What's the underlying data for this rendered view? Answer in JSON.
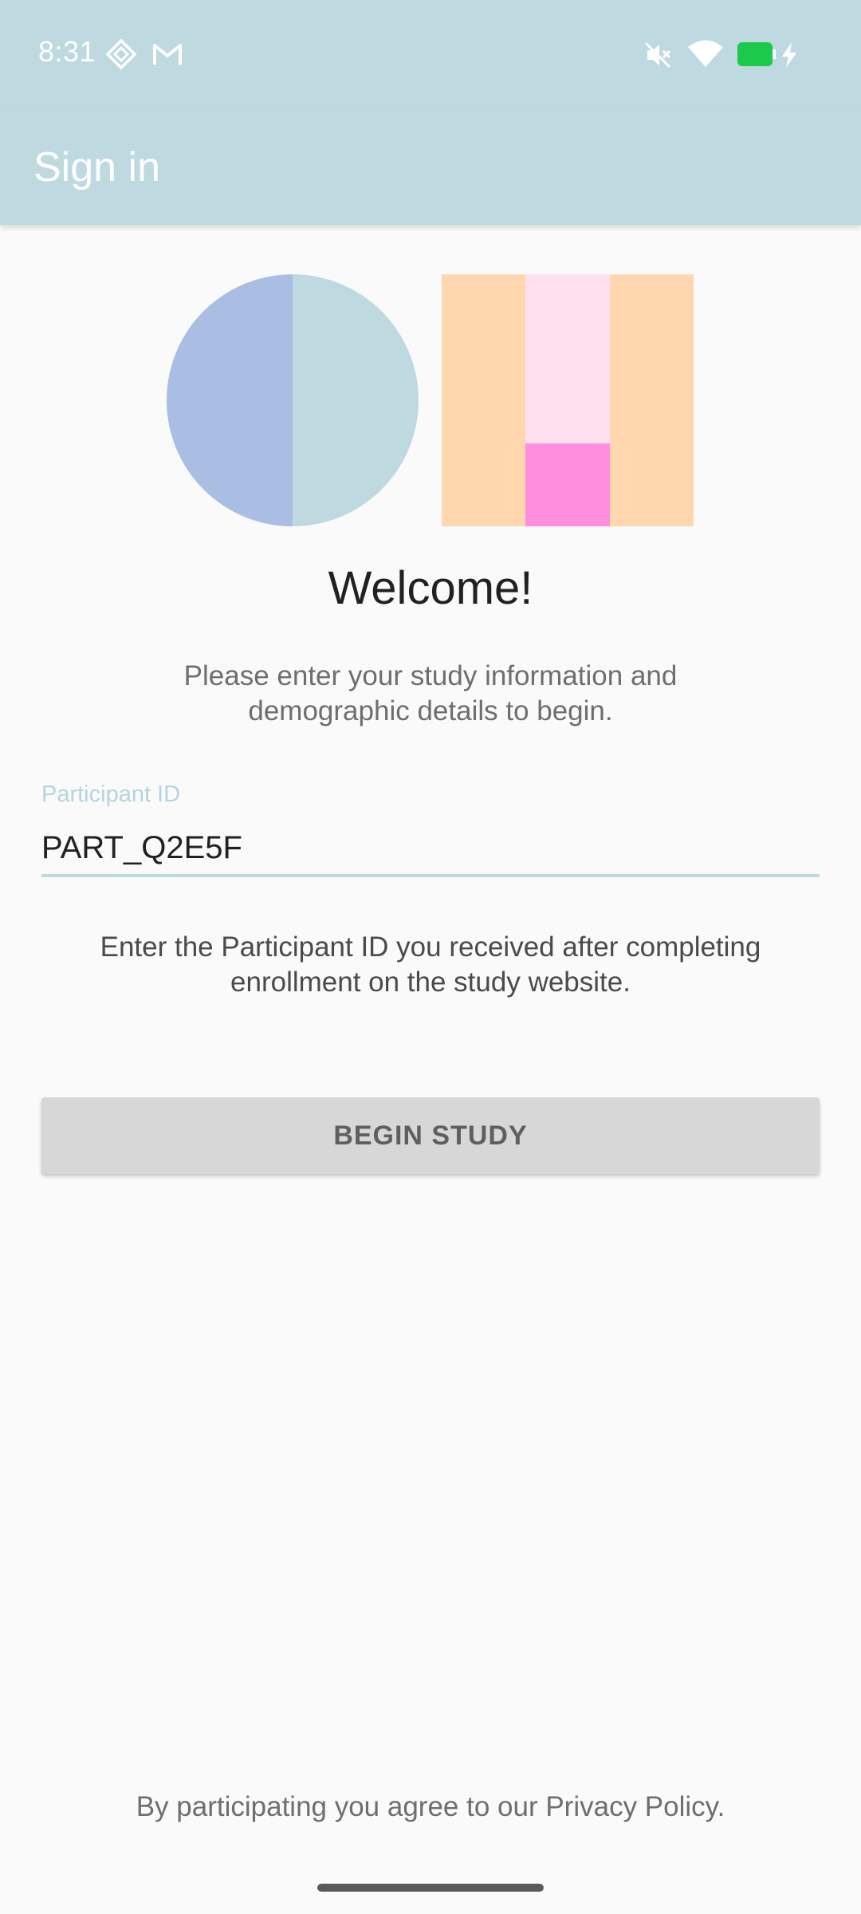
{
  "status_bar": {
    "time": "8:31",
    "icons": [
      "diamond-notification-icon",
      "gmail-icon",
      "mute-icon",
      "wifi-icon",
      "battery-icon",
      "charging-icon"
    ],
    "battery_color": "#1DC94A"
  },
  "app_bar": {
    "title": "Sign in",
    "background": "#BFD9E1"
  },
  "logo": {
    "circle_left_color": "#AABDE3",
    "circle_right_color": "#BFD9E1",
    "rect_outer_color": "#FFD6AE",
    "rect_inner_top_color": "#FFE0EE",
    "rect_inner_bottom_color": "#FF8EDE"
  },
  "main": {
    "welcome": "Welcome!",
    "subtitle": "Please enter your study information and demographic details to begin.",
    "participant_field": {
      "label": "Participant ID",
      "value": "PART_Q2E5F"
    },
    "helper_text": "Enter the Participant ID you received after completing enrollment on the study website.",
    "begin_button": "BEGIN STUDY"
  },
  "footer": {
    "text": "By participating you agree to our Privacy Policy."
  }
}
